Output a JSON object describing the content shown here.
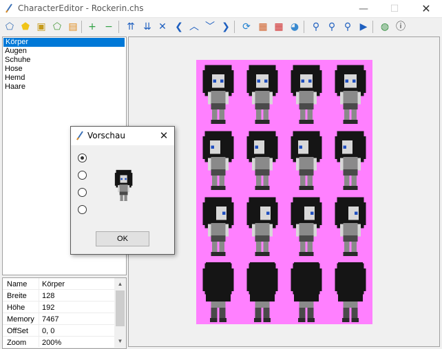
{
  "window": {
    "title": "CharacterEditor - Rockerin.chs",
    "minimize_glyph": "—",
    "maximize_glyph": "☐",
    "close_glyph": "✕"
  },
  "toolbar": {
    "buttons": [
      {
        "icon": "new-icon",
        "glyph": "⬠",
        "color": "#3a6fb5"
      },
      {
        "icon": "open-icon",
        "glyph": "⬟",
        "color": "#f0c419"
      },
      {
        "icon": "save-icon",
        "glyph": "▣",
        "color": "#c59a1b"
      },
      {
        "icon": "save-as-icon",
        "glyph": "⬠",
        "color": "#4a9a3a"
      },
      {
        "icon": "clipboard-icon",
        "glyph": "▤",
        "color": "#e08a1a"
      },
      {
        "icon": "add-icon",
        "glyph": "+",
        "color": "#2ea043"
      },
      {
        "icon": "remove-icon",
        "glyph": "−",
        "color": "#2ea043"
      },
      {
        "icon": "move-top-icon",
        "glyph": "⇈",
        "color": "#1e5fbf"
      },
      {
        "icon": "move-bottom-icon",
        "glyph": "⇊",
        "color": "#1e5fbf"
      },
      {
        "icon": "delete-icon",
        "glyph": "✕",
        "color": "#1e5fbf"
      },
      {
        "icon": "left-icon",
        "glyph": "❮",
        "color": "#1e5fbf"
      },
      {
        "icon": "up-icon",
        "glyph": "︿",
        "color": "#1e5fbf"
      },
      {
        "icon": "down-icon",
        "glyph": "﹀",
        "color": "#1e5fbf"
      },
      {
        "icon": "right-icon",
        "glyph": "❯",
        "color": "#1e5fbf"
      },
      {
        "icon": "refresh-icon",
        "glyph": "⟳",
        "color": "#1e7fd0"
      },
      {
        "icon": "image-icon",
        "glyph": "▦",
        "color": "#d0602a"
      },
      {
        "icon": "delete-image-icon",
        "glyph": "▦",
        "color": "#d02a2a"
      },
      {
        "icon": "palette-icon",
        "glyph": "◕",
        "color": "#3a8ad0"
      },
      {
        "icon": "zoom-in-icon",
        "glyph": "⚲",
        "color": "#1e5fbf"
      },
      {
        "icon": "zoom-out-icon",
        "glyph": "⚲",
        "color": "#1e5fbf"
      },
      {
        "icon": "zoom-reset-icon",
        "glyph": "⚲",
        "color": "#1e5fbf"
      },
      {
        "icon": "play-icon",
        "glyph": "▶",
        "color": "#1e5fbf"
      },
      {
        "icon": "globe-icon",
        "glyph": "◍",
        "color": "#2e8b3a"
      },
      {
        "icon": "info-icon",
        "glyph": "ⓘ",
        "color": "#333333"
      }
    ]
  },
  "layers": {
    "selected_index": 0,
    "items": [
      "Körper",
      "Augen",
      "Schuhe",
      "Hose",
      "Hemd",
      "Haare"
    ]
  },
  "properties": {
    "rows": [
      {
        "key": "Name",
        "value": "Körper"
      },
      {
        "key": "Breite",
        "value": "128"
      },
      {
        "key": "Höhe",
        "value": "192"
      },
      {
        "key": "Memory",
        "value": "7467"
      },
      {
        "key": "OffSet",
        "value": "0, 0"
      },
      {
        "key": "Zoom",
        "value": "200%"
      }
    ],
    "scroll_up": "▲",
    "scroll_down": "▼"
  },
  "sprite_sheet": {
    "background": "#ff80ff",
    "rows": 4,
    "columns": 4,
    "description": [
      "front",
      "left",
      "right",
      "back"
    ]
  },
  "preview_dialog": {
    "title": "Vorschau",
    "close_glyph": "✕",
    "selected_option": 0,
    "options_count": 4,
    "ok_label": "OK"
  }
}
